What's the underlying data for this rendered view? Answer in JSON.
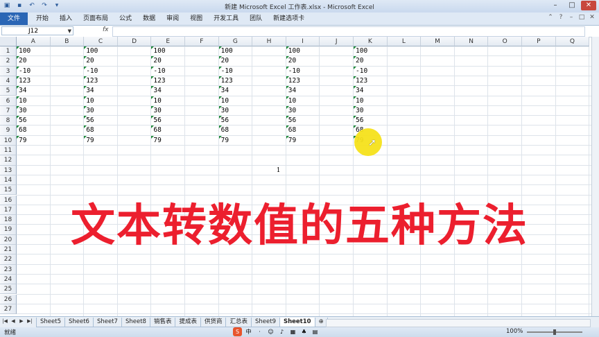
{
  "window": {
    "title": "新建 Microsoft Excel 工作表.xlsx - Microsoft Excel"
  },
  "ribbon": {
    "file_tab": "文件",
    "tabs": [
      "开始",
      "插入",
      "页面布局",
      "公式",
      "数据",
      "审阅",
      "视图",
      "开发工具",
      "团队",
      "新建选项卡"
    ]
  },
  "formula_bar": {
    "name_box": "J12",
    "fx": "fx",
    "formula": ""
  },
  "columns": [
    "A",
    "B",
    "C",
    "D",
    "E",
    "F",
    "G",
    "H",
    "I",
    "J",
    "K",
    "L",
    "M",
    "N",
    "O",
    "P",
    "Q"
  ],
  "rows": [
    "1",
    "2",
    "3",
    "4",
    "5",
    "6",
    "7",
    "8",
    "9",
    "10",
    "11",
    "12",
    "13",
    "14",
    "15",
    "16",
    "17",
    "18",
    "19",
    "20",
    "21",
    "22",
    "23",
    "24",
    "25",
    "26",
    "27"
  ],
  "values": [
    "100",
    "20",
    "-10",
    "123",
    "34",
    "10",
    "30",
    "56",
    "68",
    "79"
  ],
  "text_columns": [
    "A",
    "C",
    "E",
    "G",
    "I",
    "K"
  ],
  "cell_h13": "1",
  "overlay_title": "文本转数值的五种方法",
  "sheet_tabs": [
    "Sheet5",
    "Sheet6",
    "Sheet7",
    "Sheet8",
    "销售表",
    "提成表",
    "供货商",
    "汇总表",
    "Sheet9",
    "Sheet10"
  ],
  "active_sheet": "Sheet10",
  "status": {
    "ready": "就绪",
    "zoom": "100%"
  },
  "colors": {
    "overlay_text": "#ec1f2e",
    "highlight": "#f5e21b",
    "file_tab": "#2a66b5",
    "text_number_marker": "#1f8a3a"
  }
}
